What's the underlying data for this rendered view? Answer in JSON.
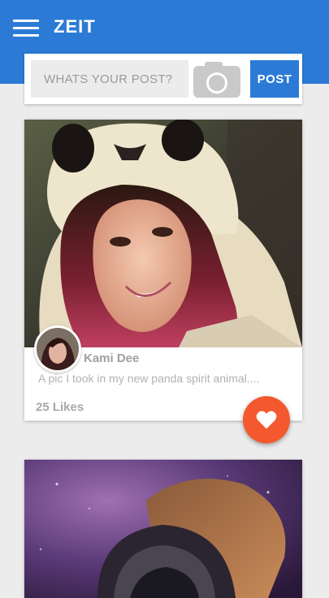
{
  "app": {
    "title": "ZEIT"
  },
  "composer": {
    "placeholder": "WHATS YOUR POST?",
    "post_label": "POST"
  },
  "posts": [
    {
      "author": "Kami Dee",
      "caption": "A pic I took in my new panda spirit animal....",
      "likes": "25 Likes"
    }
  ],
  "colors": {
    "appbar": "#2b7bd6",
    "accent_button": "#2b7bd6",
    "like_fab": "#f4582e",
    "background": "#ececec"
  },
  "icons": {
    "menu": "hamburger-menu-icon",
    "camera": "camera-icon",
    "like": "heart-icon"
  }
}
